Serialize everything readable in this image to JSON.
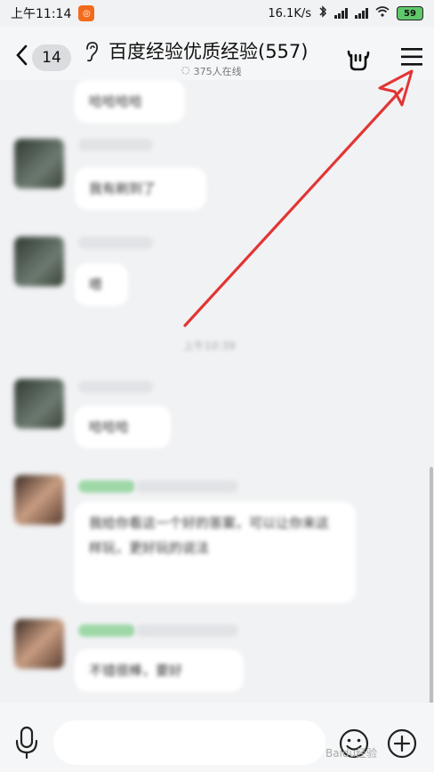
{
  "status_bar": {
    "time": "上午11:14",
    "network_speed": "16.1K/s",
    "battery": "59"
  },
  "header": {
    "unread_count": "14",
    "title": "百度经验优质经验(557)",
    "online_status": "375人在线"
  },
  "chat": {
    "messages": [
      {
        "text": "哈哈哈哈"
      },
      {
        "text": "我有刷到了"
      },
      {
        "text": "嗯"
      },
      {
        "text": "哈哈哈"
      },
      {
        "text": "我给你看这一个好的答案，可以让你来这样玩，更好玩的说法"
      },
      {
        "text": "不错很棒，要好"
      }
    ],
    "timestamp": "上午10:39"
  },
  "input_bar": {
    "placeholder": ""
  },
  "watermark": "Baidu经验",
  "colors": {
    "annotation_arrow": "#e23535",
    "header_bg": "#f5f6f7",
    "chat_bg": "#f1f2f4"
  },
  "icons": [
    "back-icon",
    "ear-icon",
    "gesture-icon",
    "menu-icon",
    "mic-icon",
    "emoji-icon",
    "plus-icon"
  ]
}
